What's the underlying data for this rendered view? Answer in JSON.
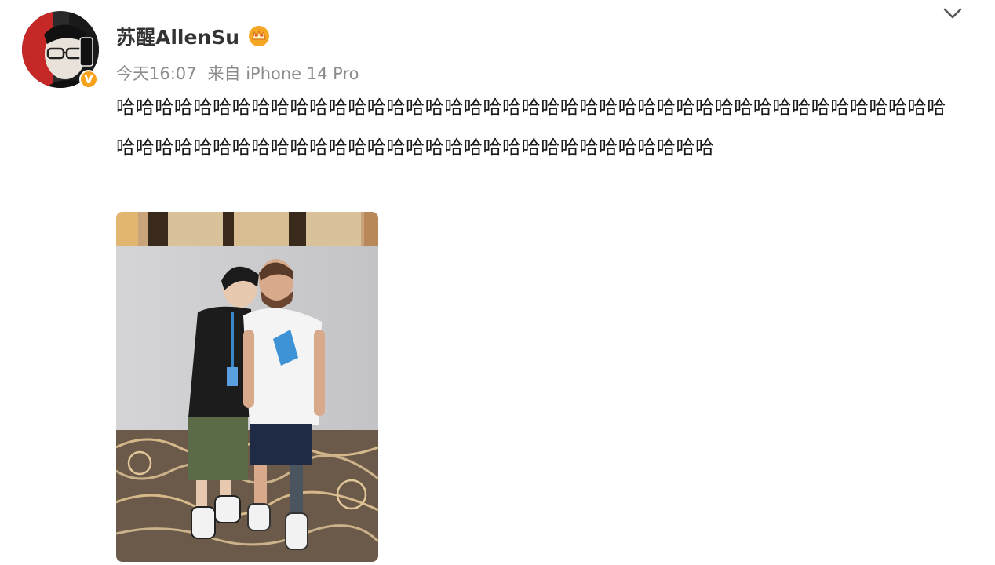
{
  "post": {
    "username": "苏醒AllenSu",
    "timestamp": "今天16:07",
    "source": "来自 iPhone 14 Pro",
    "text": "哈哈哈哈哈哈哈哈哈哈哈哈哈哈哈哈哈哈哈哈哈哈哈哈哈哈哈哈哈哈哈哈哈哈哈哈哈哈哈哈哈哈哈哈哈哈哈哈哈哈哈哈哈哈哈哈哈哈哈哈哈哈哈哈哈哈哈哈哈哈哈哈哈哈",
    "verified_badge": "V",
    "icons": {
      "avatar": "user-avatar",
      "verified": "verified-badge-icon",
      "vip": "vip-crown-icon",
      "menu": "chevron-down-icon"
    },
    "photo": "two-people-posing-photo"
  },
  "colors": {
    "username": "#333333",
    "meta": "#8c8c8c",
    "text": "#1a1a1a",
    "verified": "#f7a21b",
    "vip": "#f5a623"
  }
}
